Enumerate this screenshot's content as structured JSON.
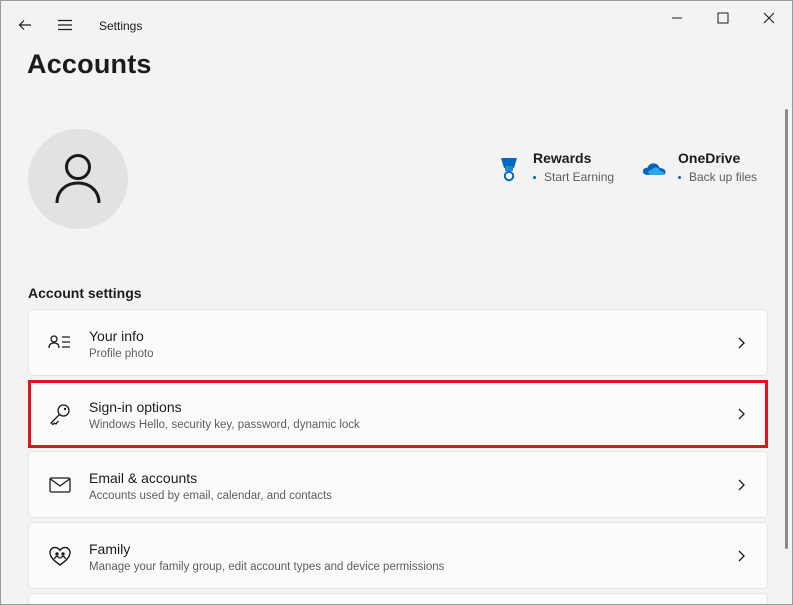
{
  "titlebar": {
    "title": "Settings"
  },
  "page": {
    "title": "Accounts"
  },
  "services": [
    {
      "name": "Rewards",
      "status": "Start Earning",
      "icon": "rewards-medal-icon"
    },
    {
      "name": "OneDrive",
      "status": "Back up files",
      "icon": "onedrive-cloud-icon"
    }
  ],
  "section": {
    "label": "Account settings"
  },
  "items": [
    {
      "title": "Your info",
      "subtitle": "Profile photo",
      "icon": "person-info-icon"
    },
    {
      "title": "Sign-in options",
      "subtitle": "Windows Hello, security key, password, dynamic lock",
      "icon": "key-icon"
    },
    {
      "title": "Email & accounts",
      "subtitle": "Accounts used by email, calendar, and contacts",
      "icon": "mail-icon"
    },
    {
      "title": "Family",
      "subtitle": "Manage your family group, edit account types and device permissions",
      "icon": "family-heart-icon"
    }
  ],
  "colors": {
    "highlight": "#e2131e",
    "accent": "#0067c0"
  }
}
